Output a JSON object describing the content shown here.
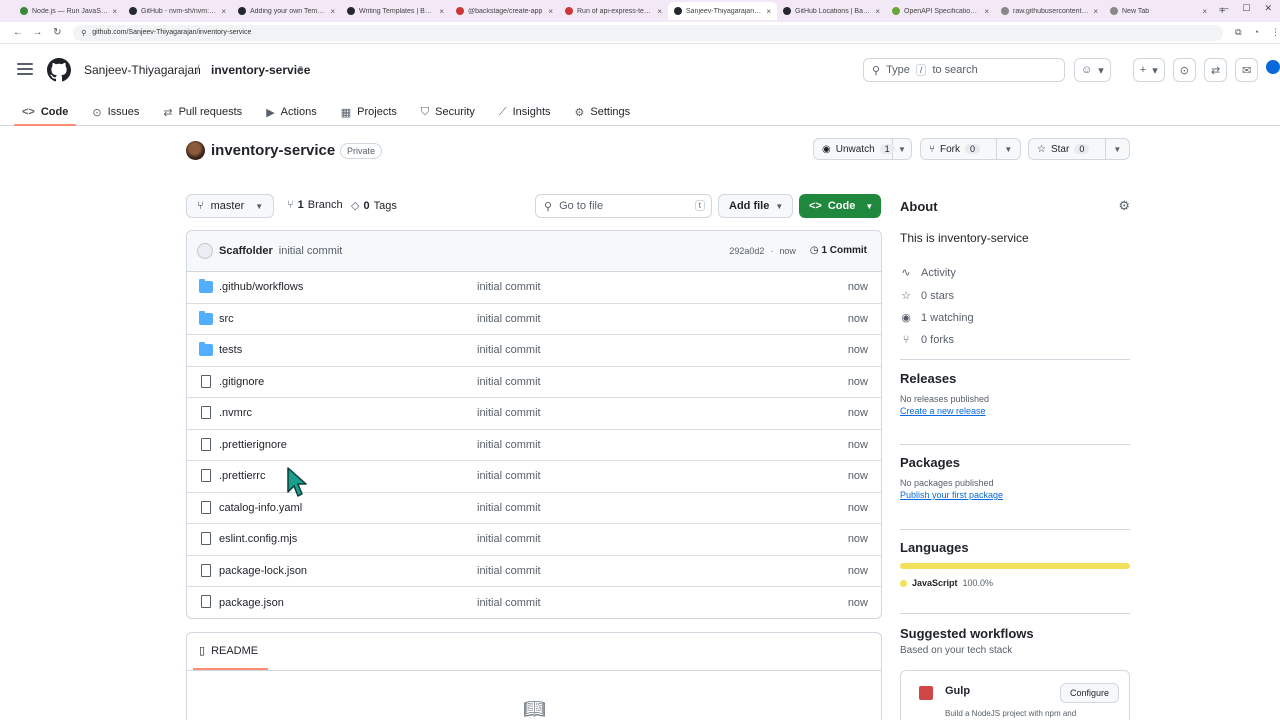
{
  "browser": {
    "tabs": [
      {
        "title": "Node.js — Run JavaScript",
        "color": "#3c873a"
      },
      {
        "title": "GitHub - nvm-sh/nvm: No",
        "color": "#24292f"
      },
      {
        "title": "Adding your own Template",
        "color": "#24292f"
      },
      {
        "title": "Writing Templates | Backs",
        "color": "#24292f"
      },
      {
        "title": "@backstage/create-app",
        "color": "#cb3837"
      },
      {
        "title": "Run of api-express-templ",
        "color": "#cb3837"
      },
      {
        "title": "Sanjeev-Thiyagarajan/inv",
        "color": "#24292f",
        "active": true
      },
      {
        "title": "GitHub Locations | Backst",
        "color": "#24292f"
      },
      {
        "title": "OpenAPI Specification - V",
        "color": "#6ba539"
      },
      {
        "title": "raw.githubusercontent.co",
        "color": "#888888"
      },
      {
        "title": "New Tab",
        "color": "#888888"
      }
    ],
    "url": "github.com/Sanjeev-Thiyagarajan/inventory-service"
  },
  "header": {
    "owner": "Sanjeev-Thiyagarajan",
    "slash": "/",
    "repo": "inventory-service",
    "search_type": "Type",
    "search_key": "/",
    "search_rest": "to search"
  },
  "repo_nav": [
    {
      "label": "Code",
      "icon": "code-icon",
      "glyph": "<>",
      "active": true
    },
    {
      "label": "Issues",
      "icon": "issue-icon",
      "glyph": "⊙"
    },
    {
      "label": "Pull requests",
      "icon": "pull-request-icon",
      "glyph": "⇄"
    },
    {
      "label": "Actions",
      "icon": "play-icon",
      "glyph": "▶"
    },
    {
      "label": "Projects",
      "icon": "table-icon",
      "glyph": "▦"
    },
    {
      "label": "Security",
      "icon": "shield-icon",
      "glyph": "⛉"
    },
    {
      "label": "Insights",
      "icon": "graph-icon",
      "glyph": "⟋"
    },
    {
      "label": "Settings",
      "icon": "gear-icon",
      "glyph": "⚙"
    }
  ],
  "repo": {
    "title": "inventory-service",
    "visibility": "Private",
    "watch_label": "Unwatch",
    "watch_count": "1",
    "fork_label": "Fork",
    "fork_count": "0",
    "star_label": "Star",
    "star_count": "0"
  },
  "branch_row": {
    "branch": "master",
    "branches_count": "1",
    "branches_label": "Branch",
    "tags_count": "0",
    "tags_label": "Tags",
    "goto_placeholder": "Go to file",
    "goto_key": "t",
    "add_file": "Add file",
    "code": "Code"
  },
  "commit": {
    "author": "Scaffolder",
    "message": "initial commit",
    "sha": "292a0d2",
    "sep": "·",
    "time": "now",
    "commits_label": "1 Commit"
  },
  "files": [
    {
      "name": ".github/workflows",
      "type": "dir",
      "msg": "initial commit",
      "time": "now"
    },
    {
      "name": "src",
      "type": "dir",
      "msg": "initial commit",
      "time": "now"
    },
    {
      "name": "tests",
      "type": "dir",
      "msg": "initial commit",
      "time": "now"
    },
    {
      "name": ".gitignore",
      "type": "file",
      "msg": "initial commit",
      "time": "now"
    },
    {
      "name": ".nvmrc",
      "type": "file",
      "msg": "initial commit",
      "time": "now"
    },
    {
      "name": ".prettierignore",
      "type": "file",
      "msg": "initial commit",
      "time": "now"
    },
    {
      "name": ".prettierrc",
      "type": "file",
      "msg": "initial commit",
      "time": "now"
    },
    {
      "name": "catalog-info.yaml",
      "type": "file",
      "msg": "initial commit",
      "time": "now"
    },
    {
      "name": "eslint.config.mjs",
      "type": "file",
      "msg": "initial commit",
      "time": "now"
    },
    {
      "name": "package-lock.json",
      "type": "file",
      "msg": "initial commit",
      "time": "now"
    },
    {
      "name": "package.json",
      "type": "file",
      "msg": "initial commit",
      "time": "now"
    }
  ],
  "readme": {
    "tab": "README"
  },
  "sidebar": {
    "about_title": "About",
    "description": "This is inventory-service",
    "stats": [
      {
        "icon": "pulse-icon",
        "glyph": "∿",
        "label": "Activity"
      },
      {
        "icon": "star-icon",
        "glyph": "☆",
        "label": "0 stars"
      },
      {
        "icon": "eye-icon",
        "glyph": "◉",
        "label": "1 watching"
      },
      {
        "icon": "fork-icon",
        "glyph": "⑂",
        "label": "0 forks"
      }
    ],
    "releases_title": "Releases",
    "releases_none": "No releases published",
    "releases_link": "Create a new release",
    "packages_title": "Packages",
    "packages_none": "No packages published",
    "packages_link": "Publish your first package",
    "languages_title": "Languages",
    "language_name": "JavaScript",
    "language_pct": "100.0%",
    "language_share": 1.0,
    "language_color": "#f1e05a",
    "workflows_title": "Suggested workflows",
    "workflows_sub": "Based on your tech stack",
    "workflow_name": "Gulp",
    "workflow_button": "Configure",
    "workflow_desc": "Build a NodeJS project with npm and"
  }
}
